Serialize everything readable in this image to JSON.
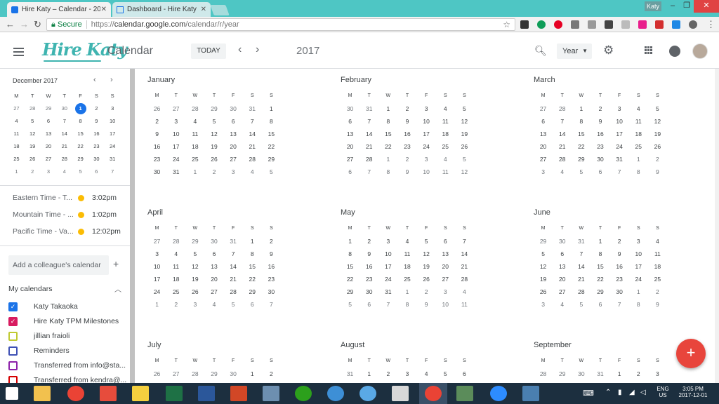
{
  "browser": {
    "tabs": [
      {
        "title": "Hire Katy – Calendar - 20",
        "active": true
      },
      {
        "title": "Dashboard - Hire Katy",
        "active": false
      }
    ],
    "user": "Katy",
    "secure_label": "Secure",
    "url_scheme": "https://",
    "url_host": "calendar.google.com",
    "url_path": "/calendar/r/year"
  },
  "header": {
    "logo_text": "Hire Katy",
    "app_name": "Calendar",
    "today_label": "TODAY",
    "year": "2017",
    "view_label": "Year"
  },
  "sidebar": {
    "mini_title": "December 2017",
    "weekday_headers": [
      "M",
      "T",
      "W",
      "T",
      "F",
      "S",
      "S"
    ],
    "mini_weeks": [
      [
        "27",
        "28",
        "29",
        "30",
        "1",
        "2",
        "3"
      ],
      [
        "4",
        "5",
        "6",
        "7",
        "8",
        "9",
        "10"
      ],
      [
        "11",
        "12",
        "13",
        "14",
        "15",
        "16",
        "17"
      ],
      [
        "18",
        "19",
        "20",
        "21",
        "22",
        "23",
        "24"
      ],
      [
        "25",
        "26",
        "27",
        "28",
        "29",
        "30",
        "31"
      ],
      [
        "1",
        "2",
        "3",
        "4",
        "5",
        "6",
        "7"
      ]
    ],
    "timezones": [
      {
        "name": "Eastern Time - T...",
        "time": "3:02pm"
      },
      {
        "name": "Mountain Time - ...",
        "time": "1:02pm"
      },
      {
        "name": "Pacific Time - Va...",
        "time": "12:02pm"
      }
    ],
    "add_colleague": "Add a colleague's calendar",
    "my_calendars_label": "My calendars",
    "calendars": [
      {
        "name": "Katy Takaoka",
        "color": "#1a73e8",
        "checked": true
      },
      {
        "name": "Hire Katy TPM Milestones",
        "color": "#d81b60",
        "checked": true
      },
      {
        "name": "jillian fraioli",
        "color": "#c0ca33",
        "checked": false
      },
      {
        "name": "Reminders",
        "color": "#3f51b5",
        "checked": false
      },
      {
        "name": "Transferred from info@sta...",
        "color": "#8e24aa",
        "checked": false
      },
      {
        "name": "Transferred from kendra@...",
        "color": "#d50000",
        "checked": false
      }
    ]
  },
  "year_view": {
    "weekday_headers": [
      "M",
      "T",
      "W",
      "T",
      "F",
      "S",
      "S"
    ],
    "months": [
      {
        "name": "January",
        "weeks": [
          [
            "26",
            "27",
            "28",
            "29",
            "30",
            "31",
            "1"
          ],
          [
            "2",
            "3",
            "4",
            "5",
            "6",
            "7",
            "8"
          ],
          [
            "9",
            "10",
            "11",
            "12",
            "13",
            "14",
            "15"
          ],
          [
            "16",
            "17",
            "18",
            "19",
            "20",
            "21",
            "22"
          ],
          [
            "23",
            "24",
            "25",
            "26",
            "27",
            "28",
            "29"
          ],
          [
            "30",
            "31",
            "1",
            "2",
            "3",
            "4",
            "5"
          ]
        ],
        "dim_first": 6,
        "dim_last": 5
      },
      {
        "name": "February",
        "weeks": [
          [
            "30",
            "31",
            "1",
            "2",
            "3",
            "4",
            "5"
          ],
          [
            "6",
            "7",
            "8",
            "9",
            "10",
            "11",
            "12"
          ],
          [
            "13",
            "14",
            "15",
            "16",
            "17",
            "18",
            "19"
          ],
          [
            "20",
            "21",
            "22",
            "23",
            "24",
            "25",
            "26"
          ],
          [
            "27",
            "28",
            "1",
            "2",
            "3",
            "4",
            "5"
          ],
          [
            "6",
            "7",
            "8",
            "9",
            "10",
            "11",
            "12"
          ]
        ],
        "dim_first": 2,
        "dim_last": 12
      },
      {
        "name": "March",
        "weeks": [
          [
            "27",
            "28",
            "1",
            "2",
            "3",
            "4",
            "5"
          ],
          [
            "6",
            "7",
            "8",
            "9",
            "10",
            "11",
            "12"
          ],
          [
            "13",
            "14",
            "15",
            "16",
            "17",
            "18",
            "19"
          ],
          [
            "20",
            "21",
            "22",
            "23",
            "24",
            "25",
            "26"
          ],
          [
            "27",
            "28",
            "29",
            "30",
            "31",
            "1",
            "2"
          ],
          [
            "3",
            "4",
            "5",
            "6",
            "7",
            "8",
            "9"
          ]
        ],
        "dim_first": 2,
        "dim_last": 9
      },
      {
        "name": "April",
        "weeks": [
          [
            "27",
            "28",
            "29",
            "30",
            "31",
            "1",
            "2"
          ],
          [
            "3",
            "4",
            "5",
            "6",
            "7",
            "8",
            "9"
          ],
          [
            "10",
            "11",
            "12",
            "13",
            "14",
            "15",
            "16"
          ],
          [
            "17",
            "18",
            "19",
            "20",
            "21",
            "22",
            "23"
          ],
          [
            "24",
            "25",
            "26",
            "27",
            "28",
            "29",
            "30"
          ],
          [
            "1",
            "2",
            "3",
            "4",
            "5",
            "6",
            "7"
          ]
        ],
        "dim_first": 5,
        "dim_last": 7
      },
      {
        "name": "May",
        "weeks": [
          [
            "1",
            "2",
            "3",
            "4",
            "5",
            "6",
            "7"
          ],
          [
            "8",
            "9",
            "10",
            "11",
            "12",
            "13",
            "14"
          ],
          [
            "15",
            "16",
            "17",
            "18",
            "19",
            "20",
            "21"
          ],
          [
            "22",
            "23",
            "24",
            "25",
            "26",
            "27",
            "28"
          ],
          [
            "29",
            "30",
            "31",
            "1",
            "2",
            "3",
            "4"
          ],
          [
            "5",
            "6",
            "7",
            "8",
            "9",
            "10",
            "11"
          ]
        ],
        "dim_first": 0,
        "dim_last": 11
      },
      {
        "name": "June",
        "weeks": [
          [
            "29",
            "30",
            "31",
            "1",
            "2",
            "3",
            "4"
          ],
          [
            "5",
            "6",
            "7",
            "8",
            "9",
            "10",
            "11"
          ],
          [
            "12",
            "13",
            "14",
            "15",
            "16",
            "17",
            "18"
          ],
          [
            "19",
            "20",
            "21",
            "22",
            "23",
            "24",
            "25"
          ],
          [
            "26",
            "27",
            "28",
            "29",
            "30",
            "1",
            "2"
          ],
          [
            "3",
            "4",
            "5",
            "6",
            "7",
            "8",
            "9"
          ]
        ],
        "dim_first": 3,
        "dim_last": 9
      },
      {
        "name": "July",
        "weeks": [
          [
            "26",
            "27",
            "28",
            "29",
            "30",
            "1",
            "2"
          ]
        ],
        "dim_first": 5,
        "dim_last": 0
      },
      {
        "name": "August",
        "weeks": [
          [
            "31",
            "1",
            "2",
            "3",
            "4",
            "5",
            "6"
          ]
        ],
        "dim_first": 1,
        "dim_last": 0
      },
      {
        "name": "September",
        "weeks": [
          [
            "28",
            "29",
            "30",
            "31",
            "1",
            "2",
            "3"
          ]
        ],
        "dim_first": 4,
        "dim_last": 0
      }
    ]
  },
  "fab_label": "+",
  "taskbar": {
    "lang": "ENG",
    "region": "US",
    "time": "3:05 PM",
    "date": "2017-12-01"
  },
  "colors": {
    "tabbar": "#4ec6c4",
    "brand": "#3fb4b0",
    "accent": "#1a73e8",
    "fab": "#e8453c",
    "taskbar": "#1c2f3f"
  }
}
